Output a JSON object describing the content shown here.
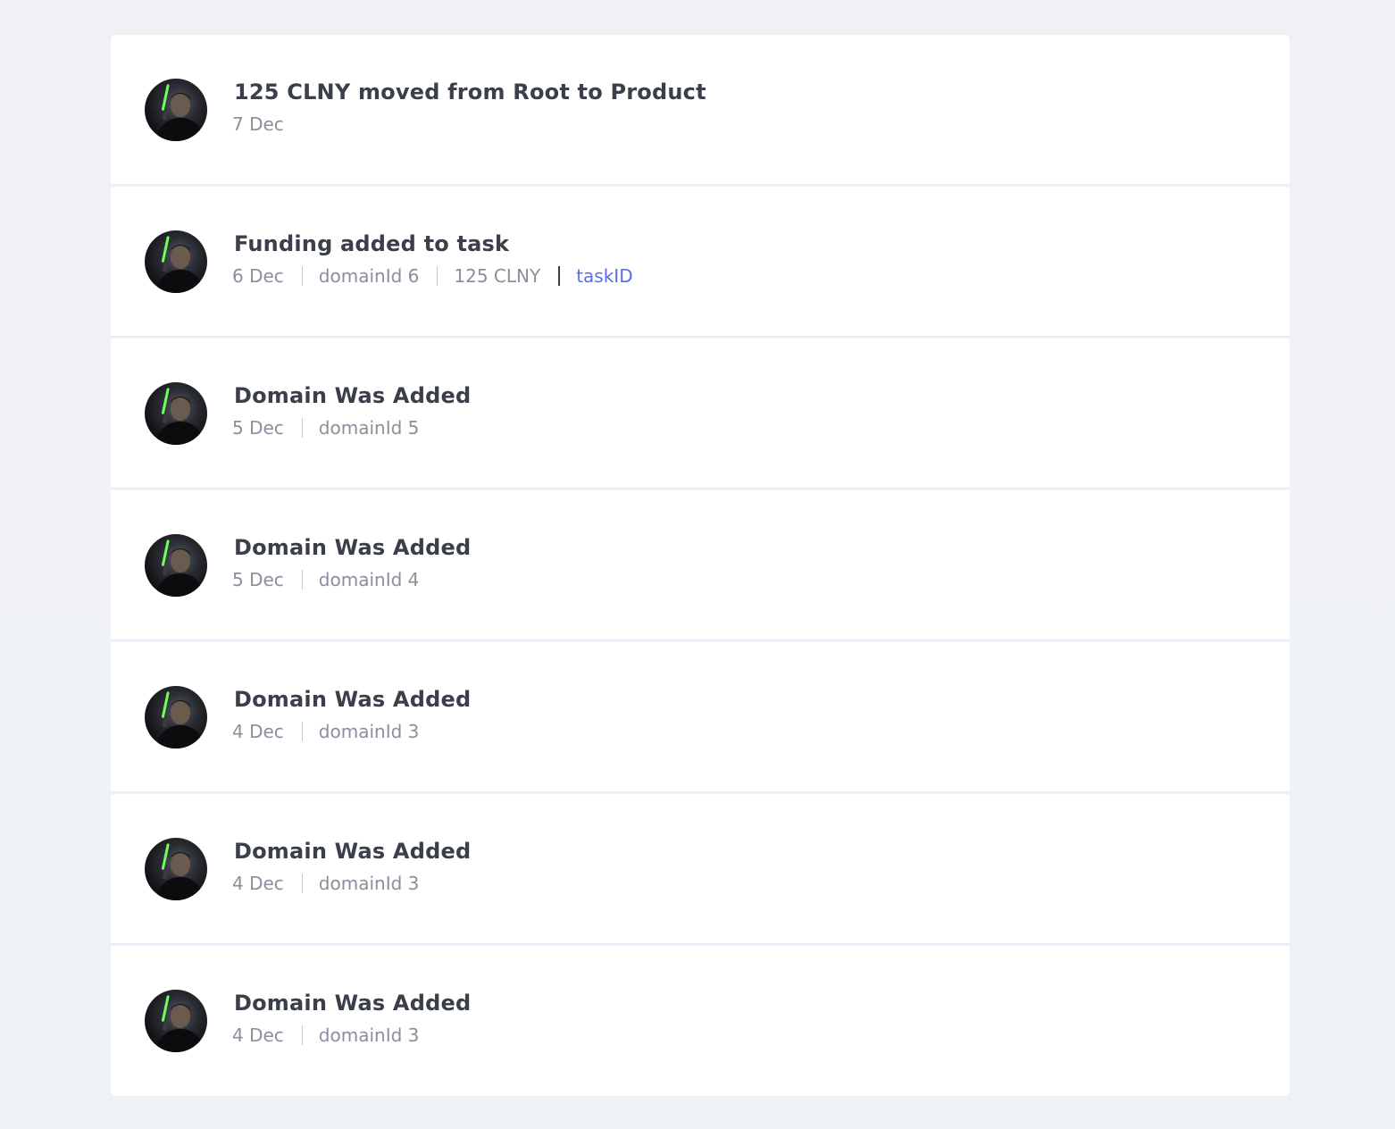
{
  "events": [
    {
      "title": "125 CLNY moved from Root to Product",
      "date": "7 Dec"
    },
    {
      "title": "Funding added to task",
      "date": "6 Dec",
      "domain": "domainId 6",
      "amount": "125 CLNY",
      "task_link": "taskID"
    },
    {
      "title": "Domain Was Added",
      "date": "5 Dec",
      "domain": "domainId 5"
    },
    {
      "title": "Domain Was Added",
      "date": "5 Dec",
      "domain": "domainId 4"
    },
    {
      "title": "Domain Was Added",
      "date": "4 Dec",
      "domain": "domainId 3"
    },
    {
      "title": "Domain Was Added",
      "date": "4 Dec",
      "domain": "domainId 3"
    },
    {
      "title": "Domain Was Added",
      "date": "4 Dec",
      "domain": "domainId 3"
    }
  ],
  "colors": {
    "title": "#3a3f4a",
    "meta": "#8a8f9c",
    "link": "#5b6cf0",
    "background": "#eef2f7"
  }
}
